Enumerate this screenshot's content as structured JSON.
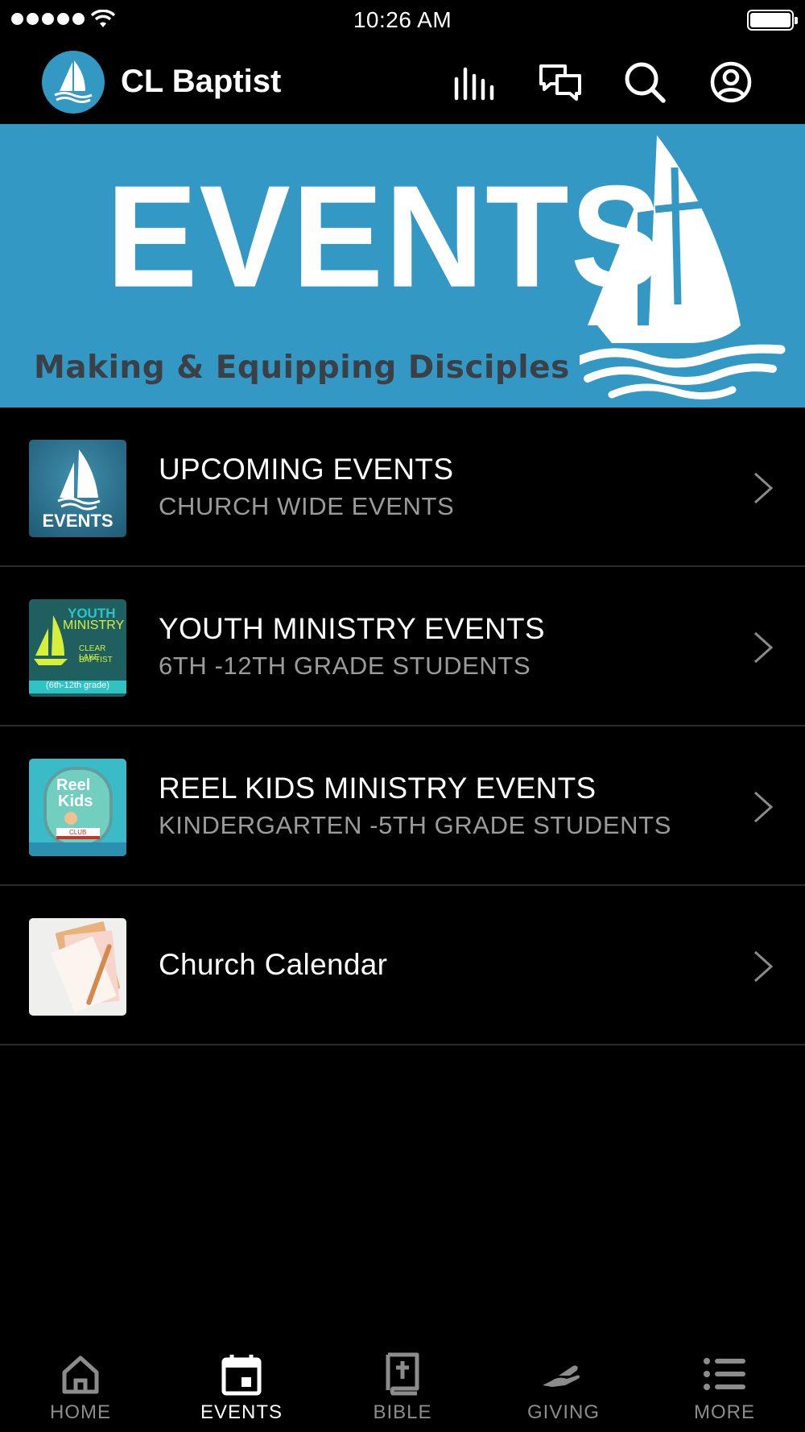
{
  "status_bar": {
    "time": "10:26 AM"
  },
  "header": {
    "app_title": "CL Baptist",
    "icons": [
      "audio-bars-icon",
      "chat-icon",
      "search-icon",
      "account-icon"
    ]
  },
  "banner": {
    "title": "EVENTS",
    "subtitle": "Making & Equipping Disciples",
    "color": "#3398c3"
  },
  "list": {
    "items": [
      {
        "title": "UPCOMING EVENTS",
        "subtitle": "CHURCH WIDE EVENTS",
        "thumb_label": "EVENTS"
      },
      {
        "title": "YOUTH MINISTRY EVENTS",
        "subtitle": "6TH -12TH GRADE STUDENTS",
        "thumb_label_1": "YOUTH",
        "thumb_label_2": "MINISTRY",
        "thumb_label_3": "CLEAR LAKE",
        "thumb_label_4": "BAPTIST",
        "thumb_label_5": "(6th-12th grade)"
      },
      {
        "title": "REEL KIDS MINISTRY EVENTS",
        "subtitle": "KINDERGARTEN -5TH GRADE STUDENTS",
        "thumb_label_1": "Reel",
        "thumb_label_2": "Kids",
        "thumb_label_3": "CLUB"
      },
      {
        "title": "Church Calendar",
        "subtitle": ""
      }
    ]
  },
  "tabs": [
    {
      "label": "HOME",
      "icon": "home-icon",
      "active": false
    },
    {
      "label": "EVENTS",
      "icon": "calendar-icon",
      "active": true
    },
    {
      "label": "BIBLE",
      "icon": "bible-icon",
      "active": false
    },
    {
      "label": "GIVING",
      "icon": "giving-hand-icon",
      "active": false
    },
    {
      "label": "MORE",
      "icon": "menu-list-icon",
      "active": false
    }
  ]
}
